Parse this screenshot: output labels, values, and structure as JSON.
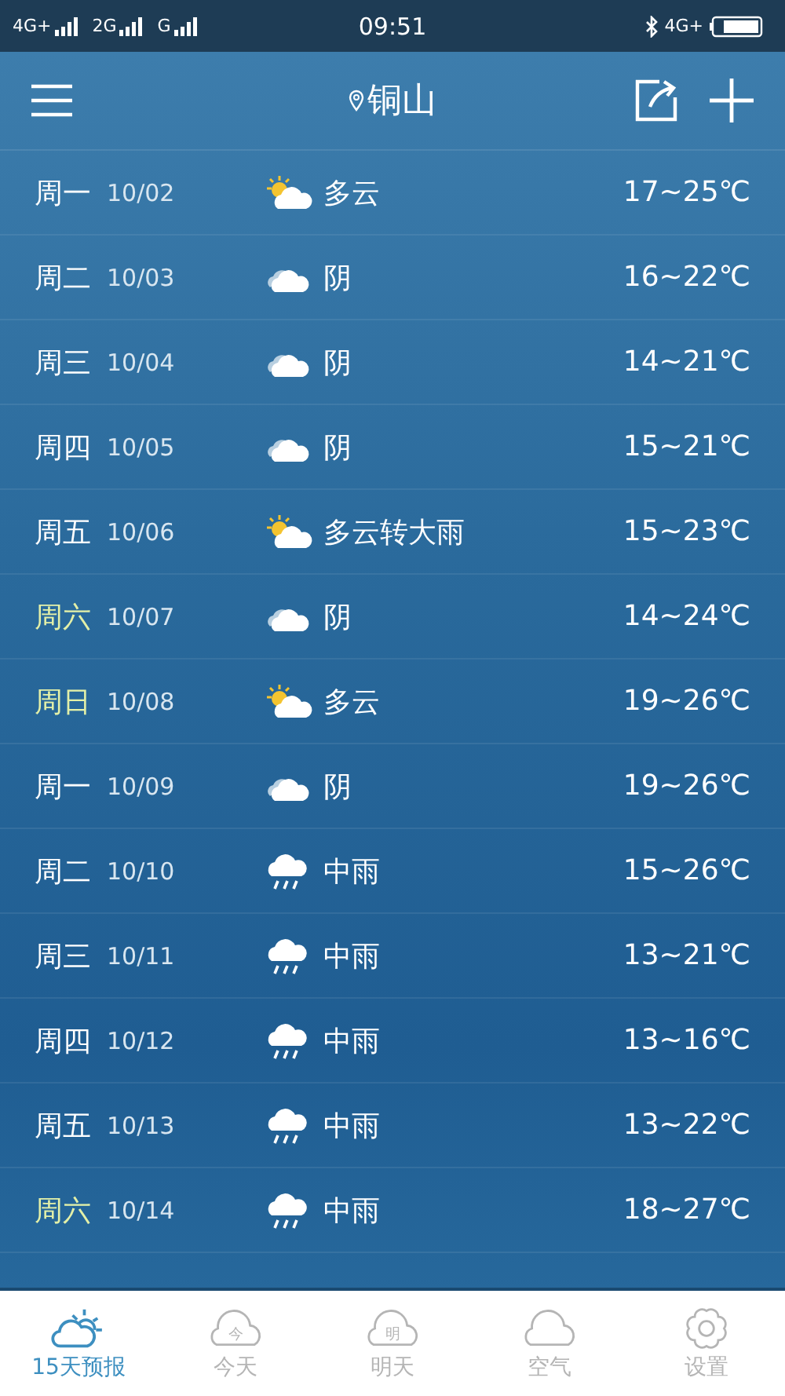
{
  "status_bar": {
    "left": [
      {
        "label": "4G+"
      },
      {
        "label": "2G"
      },
      {
        "label": "G"
      }
    ],
    "time": "09:51",
    "network": "4G+"
  },
  "header": {
    "city": "铜山"
  },
  "forecast": [
    {
      "day": "周一",
      "date": "10/02",
      "weather": "多云",
      "kind": "partly-cloudy",
      "temp": "17~25℃",
      "weekend": false
    },
    {
      "day": "周二",
      "date": "10/03",
      "weather": "阴",
      "kind": "overcast",
      "temp": "16~22℃",
      "weekend": false
    },
    {
      "day": "周三",
      "date": "10/04",
      "weather": "阴",
      "kind": "overcast",
      "temp": "14~21℃",
      "weekend": false
    },
    {
      "day": "周四",
      "date": "10/05",
      "weather": "阴",
      "kind": "overcast",
      "temp": "15~21℃",
      "weekend": false
    },
    {
      "day": "周五",
      "date": "10/06",
      "weather": "多云转大雨",
      "kind": "partly-cloudy",
      "temp": "15~23℃",
      "weekend": false
    },
    {
      "day": "周六",
      "date": "10/07",
      "weather": "阴",
      "kind": "overcast",
      "temp": "14~24℃",
      "weekend": true
    },
    {
      "day": "周日",
      "date": "10/08",
      "weather": "多云",
      "kind": "partly-cloudy",
      "temp": "19~26℃",
      "weekend": true
    },
    {
      "day": "周一",
      "date": "10/09",
      "weather": "阴",
      "kind": "overcast",
      "temp": "19~26℃",
      "weekend": false
    },
    {
      "day": "周二",
      "date": "10/10",
      "weather": "中雨",
      "kind": "rain",
      "temp": "15~26℃",
      "weekend": false
    },
    {
      "day": "周三",
      "date": "10/11",
      "weather": "中雨",
      "kind": "rain",
      "temp": "13~21℃",
      "weekend": false
    },
    {
      "day": "周四",
      "date": "10/12",
      "weather": "中雨",
      "kind": "rain",
      "temp": "13~16℃",
      "weekend": false
    },
    {
      "day": "周五",
      "date": "10/13",
      "weather": "中雨",
      "kind": "rain",
      "temp": "13~22℃",
      "weekend": false
    },
    {
      "day": "周六",
      "date": "10/14",
      "weather": "中雨",
      "kind": "rain",
      "temp": "18~27℃",
      "weekend": true
    }
  ],
  "tabs": [
    {
      "label": "15天预报",
      "kind": "sun-cloud",
      "selected": true
    },
    {
      "label": "今天",
      "kind": "cloud",
      "icon_text": "今",
      "selected": false
    },
    {
      "label": "明天",
      "kind": "cloud",
      "icon_text": "明",
      "selected": false
    },
    {
      "label": "空气",
      "kind": "plain-cloud",
      "selected": false
    },
    {
      "label": "设置",
      "kind": "gear",
      "selected": false
    }
  ]
}
